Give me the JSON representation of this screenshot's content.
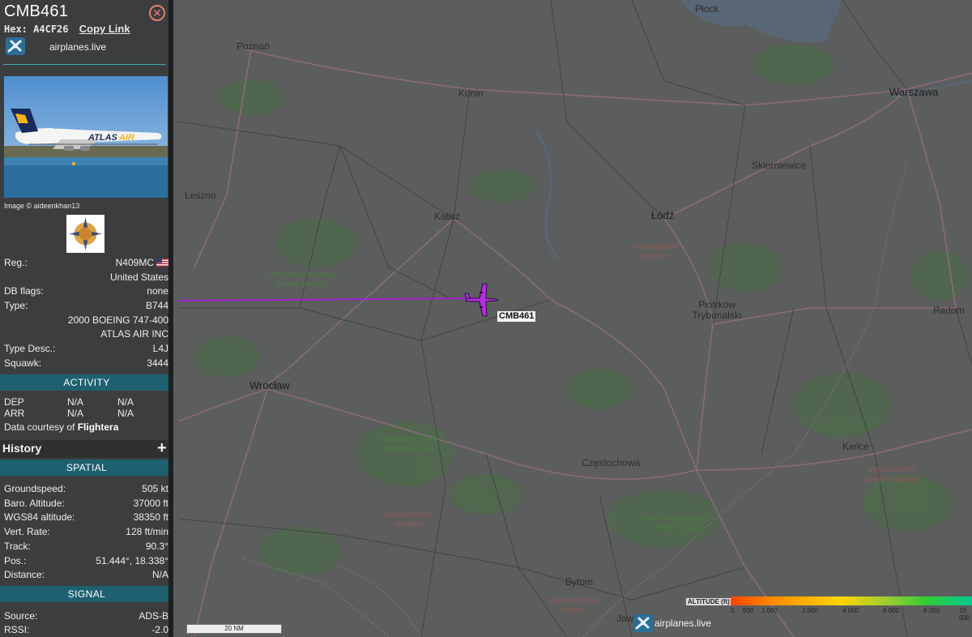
{
  "aircraft": {
    "callsign": "CMB461",
    "hex_label": "Hex:",
    "hex": "A4CF26",
    "copy_link": "Copy Link",
    "source_link": "airplanes.live",
    "photo_credit": "Image © aideenkhan13",
    "close_icon": "close-icon"
  },
  "details": [
    {
      "key": "Reg.:",
      "value": "N409MC"
    },
    {
      "key": "",
      "value": "United States"
    },
    {
      "key": "DB flags:",
      "value": "none"
    },
    {
      "key": "Type:",
      "value": "B744"
    },
    {
      "key": "",
      "value": "2000 BOEING 747-400"
    },
    {
      "key": "",
      "value": "ATLAS AIR INC"
    },
    {
      "key": "Type Desc.:",
      "value": "L4J"
    },
    {
      "key": "Squawk:",
      "value": "3444"
    }
  ],
  "activity": {
    "header": "ACTIVITY",
    "rows": [
      {
        "label": "DEP",
        "a": "N/A",
        "b": "N/A"
      },
      {
        "label": "ARR",
        "a": "N/A",
        "b": "N/A"
      }
    ],
    "courtesy_prefix": "Data courtesy of ",
    "courtesy_name": "Flightera"
  },
  "history": {
    "label": "History",
    "plus": "+"
  },
  "spatial": {
    "header": "SPATIAL",
    "rows": [
      {
        "key": "Groundspeed:",
        "value": "505 kt"
      },
      {
        "key": "Baro. Altitude:",
        "value": "37000 ft"
      },
      {
        "key": "WGS84 altitude:",
        "value": "38350 ft"
      },
      {
        "key": "Vert. Rate:",
        "value": "128 ft/min"
      },
      {
        "key": "Track:",
        "value": "90.3°"
      },
      {
        "key": "Pos.:",
        "value": "51.444°, 18.338°"
      },
      {
        "key": "Distance:",
        "value": "N/A"
      }
    ]
  },
  "signal": {
    "header": "SIGNAL",
    "rows": [
      {
        "key": "Source:",
        "value": "ADS-B"
      },
      {
        "key": "RSSI:",
        "value": "-2.0"
      }
    ]
  },
  "map": {
    "cities": [
      {
        "name": "Płock",
        "big": false
      },
      {
        "name": "Poznań",
        "big": false
      },
      {
        "name": "Konin",
        "big": false
      },
      {
        "name": "Warszawa",
        "big": true
      },
      {
        "name": "Skierniewice",
        "big": false
      },
      {
        "name": "Leszno",
        "big": false
      },
      {
        "name": "Kalisz",
        "big": false
      },
      {
        "name": "Łódź",
        "big": true
      },
      {
        "name": "Piotrków Trybunalski",
        "big": false
      },
      {
        "name": "Radom",
        "big": false
      },
      {
        "name": "Wrocław",
        "big": true
      },
      {
        "name": "Kielce",
        "big": false
      },
      {
        "name": "Częstochowa",
        "big": false
      },
      {
        "name": "Bytom",
        "big": false
      },
      {
        "name": "Jaw",
        "big": false
      }
    ],
    "parks": [
      "Park Krajobrazowy Dolina Baryczy",
      "Stobrawski Park Krajobrazowy",
      "Park Krajobrazowy Orlich Gniazd"
    ],
    "regions": [
      "województwo łódzkie",
      "województwo świętokrzyskie",
      "województwo opolskie",
      "województwo śląskie"
    ],
    "aircraft_label": "CMB461",
    "scale_label": "20 NM",
    "watermark": "airplanes.live",
    "altitude_legend": {
      "label": "ALTITUDE (ft)",
      "ticks": [
        "0",
        "500",
        "1 000",
        "2 000",
        "4 000",
        "6 000",
        "8 000",
        "10 000"
      ]
    },
    "track_color": "#a020d0",
    "aircraft_color": "#b42ee0"
  }
}
